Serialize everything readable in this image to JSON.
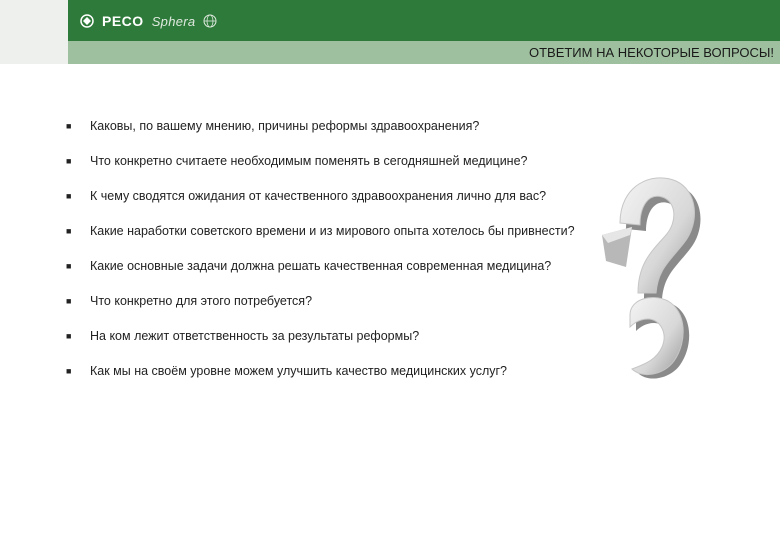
{
  "header": {
    "logo_primary": "PECO",
    "logo_secondary": "Sphera",
    "title": "ОТВЕТИМ НА НЕКОТОРЫЕ ВОПРОСЫ!"
  },
  "icons": {
    "logo": "peco-logo-mark-icon",
    "globe": "globe-icon",
    "decoration": "question-mark-icon"
  },
  "colors": {
    "header_green": "#2e7a3a",
    "subheader_green": "#9fc09f"
  },
  "questions": [
    "Каковы, по вашему мнению, причины реформы здравоохранения?",
    "Что конкретно считаете необходимым поменять в сегодняшней медицине?",
    "К чему сводятся ожидания от качественного здравоохранения лично для вас?",
    "Какие наработки советского времени и из мирового опыта хотелось бы привнести?",
    "Какие основные задачи должна решать качественная современная медицина?",
    "Что конкретно для этого потребуется?",
    "На ком лежит ответственность за результаты реформы?",
    "Как мы на своём уровне можем улучшить качество медицинских услуг?"
  ]
}
